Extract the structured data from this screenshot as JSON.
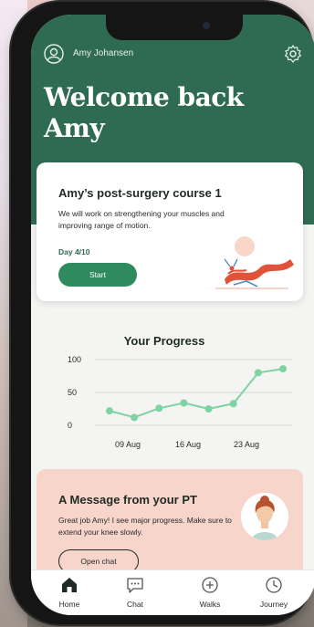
{
  "user": {
    "name": "Amy Johansen"
  },
  "header": {
    "welcome_line1": "Welcome back",
    "welcome_line2": "Amy"
  },
  "course": {
    "title": "Amy’s post-surgery course 1",
    "description": "We will work on strengthening your muscles and improving range of motion.",
    "day": "Day 4/10",
    "start_label": "Start"
  },
  "progress": {
    "title": "Your Progress"
  },
  "chart_data": {
    "type": "line",
    "title": "Your Progress",
    "y_ticks": [
      "100",
      "50",
      "0"
    ],
    "x_ticks": [
      "09 Aug",
      "16 Aug",
      "23 Aug"
    ],
    "ylim": [
      0,
      100
    ],
    "values": [
      22,
      12,
      26,
      34,
      25,
      33,
      80,
      86
    ],
    "grid": true,
    "color": "#7dd3a2"
  },
  "pt_message": {
    "title": "A Message from your PT",
    "text": "Great job Amy! I see major progress. Make sure to extend your knee slowly.",
    "button_label": "Open chat"
  },
  "nav": {
    "items": [
      {
        "label": "Home",
        "icon": "home-icon"
      },
      {
        "label": "Chat",
        "icon": "chat-icon"
      },
      {
        "label": "Walks",
        "icon": "walks-icon"
      },
      {
        "label": "Journey",
        "icon": "journey-icon"
      }
    ]
  },
  "colors": {
    "brand_green": "#2f6b52",
    "button_green": "#2f8a5e",
    "line_green": "#7dd3a2",
    "message_pink": "#f7d5ca"
  }
}
